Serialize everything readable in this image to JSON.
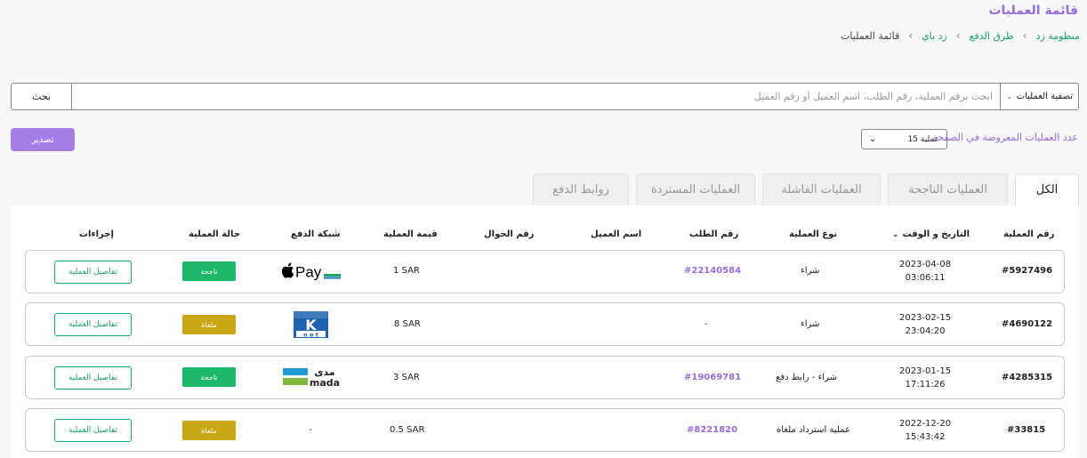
{
  "page_title": "قائمة العمليات",
  "breadcrumb": [
    {
      "label": "منظومة زد"
    },
    {
      "label": "طرق الدفع"
    },
    {
      "label": "زد باي"
    },
    {
      "label": "قائمة العمليات"
    }
  ],
  "search": {
    "filter_label": "تصفية العمليات",
    "placeholder": "ابحث برقم العملية، رقم الطلب، اسم العميل أو رقم العميل",
    "value": "",
    "button_label": "بحث"
  },
  "toolbar": {
    "export_label": "تصدير",
    "per_page_label": "عدد العمليات المعروضة في الصفحة",
    "per_page_value": "15 عملية"
  },
  "tabs": [
    {
      "label": "الكل",
      "active": true
    },
    {
      "label": "العمليات الناجحة",
      "active": false
    },
    {
      "label": "العمليات الفاشلة",
      "active": false
    },
    {
      "label": "العمليات المستردة",
      "active": false
    },
    {
      "label": "روابط الدفع",
      "active": false
    }
  ],
  "table": {
    "columns": {
      "operation_no": "رقم العملية",
      "datetime": "التاريخ و الوقت",
      "type": "نوع العملية",
      "order_no": "رقم الطلب",
      "customer_name": "اسم العميل",
      "mobile": "رقم الجوال",
      "amount": "قيمة العملية",
      "network": "شبكة الدفع",
      "status": "حالة العملية",
      "actions": "إجراءات"
    },
    "rows": [
      {
        "operation_no": "#5927496",
        "date": "2023-04-08",
        "time": "03:06:11",
        "type": "شراء",
        "order_no": "#22140584",
        "amount": "1 SAR",
        "network": "Pay",
        "network_icon": "apple-pay-icon",
        "status": "ناجحة",
        "action": "تفاصيل العملية"
      },
      {
        "operation_no": "#4690122",
        "date": "2023-02-15",
        "time": "23:04:20",
        "type": "شراء",
        "order_no": "-",
        "amount": "8 SAR",
        "network": "K net",
        "network_icon": "knet-icon",
        "status": "ملغاة",
        "action": "تفاصيل العملية"
      },
      {
        "operation_no": "#4285315",
        "date": "2023-01-15",
        "time": "17:11:26",
        "type": "شراء - رابط دفع",
        "order_no": "#19069781",
        "amount": "3 SAR",
        "network": "mada",
        "network_icon": "mada-icon",
        "status": "ناجحة",
        "action": "تفاصيل العملية"
      },
      {
        "operation_no": "#33815",
        "date": "2022-12-20",
        "time": "15:43:42",
        "type": "عملية استرداد ملغاة",
        "order_no": "#8221820",
        "amount": "0.5 SAR",
        "network": "-",
        "network_icon": "",
        "status": "ملغاة",
        "action": "تفاصيل العملية"
      }
    ]
  },
  "colors": {
    "accent_purple": "#9a6bd8",
    "brand_green": "#1aa56a",
    "status_success": "#1cb768",
    "status_canceled": "#c9a616"
  }
}
